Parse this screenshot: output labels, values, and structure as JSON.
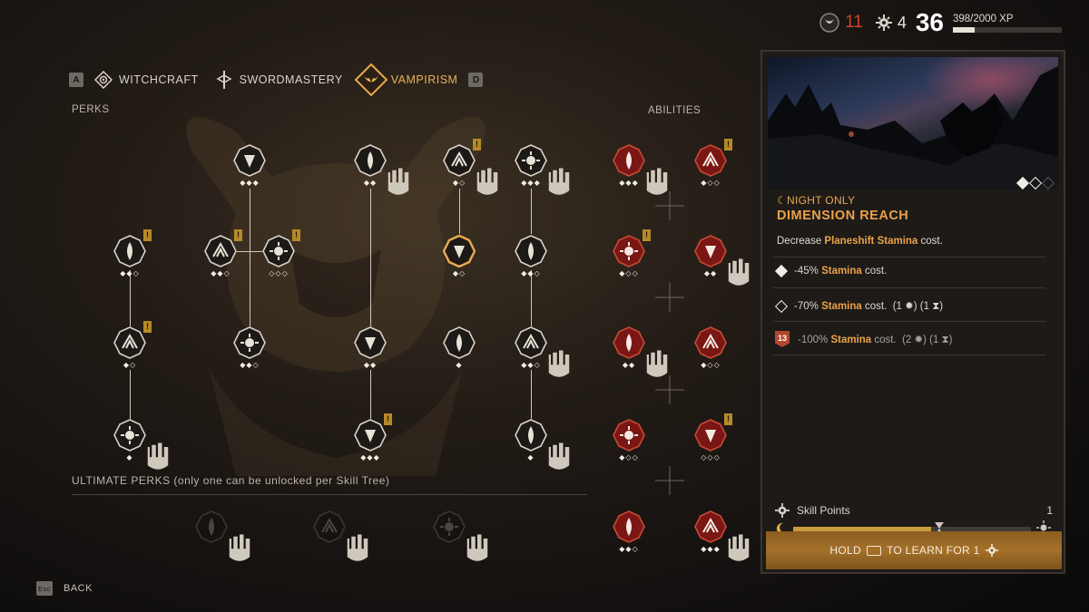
{
  "stats": {
    "blood": "11",
    "ability_points": "4",
    "level": "36",
    "xp_text": "398/2000 XP",
    "xp_progress": 0.199
  },
  "tabs": {
    "prev_key": "A",
    "next_key": "D",
    "items": [
      {
        "label": "WITCHCRAFT",
        "icon": "witchcraft-icon",
        "active": false
      },
      {
        "label": "SWORDMASTERY",
        "icon": "swordmastery-icon",
        "active": false
      },
      {
        "label": "VAMPIRISM",
        "icon": "vampirism-icon",
        "active": true
      }
    ]
  },
  "sections": {
    "perks": "PERKS",
    "abilities": "ABILITIES",
    "ultimate": "ULTIMATE PERKS (only one can be unlocked per Skill Tree)"
  },
  "perks": [
    {
      "icon": "flame-claw-icon",
      "pips": "◆◆◇",
      "alert": true,
      "locked": false
    },
    {
      "icon": "claw-bite-icon",
      "pips": "◆◆◇",
      "alert": true,
      "locked": false
    },
    {
      "icon": "sun-burst-icon",
      "pips": "◇◇◇",
      "alert": true,
      "locked": false
    },
    {
      "icon": "blood-drop-wave-icon",
      "pips": "◆◆◆",
      "alert": false,
      "locked": false
    },
    {
      "icon": "fang-icon",
      "pips": "◆◆",
      "alert": false,
      "locked": true
    },
    {
      "icon": "eye-icon",
      "pips": "◆◇",
      "alert": true,
      "locked": true
    },
    {
      "icon": "triple-drop-icon",
      "pips": "◆◆◆",
      "alert": false,
      "locked": true
    },
    {
      "icon": "mist-strike-icon",
      "pips": "◆◇",
      "alert": false,
      "locked": false
    },
    {
      "icon": "scratch-icon",
      "pips": "◆◆◇",
      "alert": false,
      "locked": false
    },
    {
      "icon": "drops-icon",
      "pips": "◆◇",
      "alert": true,
      "locked": false
    },
    {
      "icon": "paw-print-icon",
      "pips": "◆◆◇",
      "alert": false,
      "locked": false
    },
    {
      "icon": "slash-icon",
      "pips": "◆◆",
      "alert": false,
      "locked": false
    },
    {
      "icon": "demon-mask-icon",
      "pips": "◆",
      "alert": false,
      "locked": false
    },
    {
      "icon": "claw-slash-icon",
      "pips": "◆◆◇",
      "alert": false,
      "locked": true
    },
    {
      "icon": "mirror-icon",
      "pips": "◆",
      "alert": false,
      "locked": true
    },
    {
      "icon": "chalice-icon",
      "pips": "◆◆◆",
      "alert": true,
      "locked": false
    },
    {
      "icon": "hand-grab-icon",
      "pips": "◆",
      "alert": false,
      "locked": true
    }
  ],
  "abilities": [
    {
      "icon": "wolf-howl-icon",
      "pips": "◆◆◆",
      "alert": false,
      "locked": true
    },
    {
      "icon": "beast-roar-icon",
      "pips": "◆◇◇",
      "alert": true,
      "locked": false
    },
    {
      "icon": "wolf-head-icon",
      "pips": "◆◇◇",
      "alert": true,
      "locked": false
    },
    {
      "icon": "spiked-maw-icon",
      "pips": "◆◆",
      "alert": false,
      "locked": true
    },
    {
      "icon": "vortex-icon",
      "pips": "◆◆",
      "alert": false,
      "locked": true
    },
    {
      "icon": "bat-swarm-icon",
      "pips": "◆◇◇",
      "alert": false,
      "locked": false
    },
    {
      "icon": "blood-sigil-icon",
      "pips": "◆◇◇",
      "alert": false,
      "locked": false
    },
    {
      "icon": "heart-icon",
      "pips": "◇◇◇",
      "alert": true,
      "locked": false
    },
    {
      "icon": "blood-slash-icon",
      "pips": "◆◆◇",
      "alert": false,
      "locked": false
    },
    {
      "icon": "rend-icon",
      "pips": "◆◆◆",
      "alert": false,
      "locked": true
    }
  ],
  "ultimates": [
    {
      "icon": "skull-icon"
    },
    {
      "icon": "eye-fang-icon"
    },
    {
      "icon": "rune-icon"
    }
  ],
  "detail": {
    "condition": "☾NIGHT ONLY",
    "name": "DIMENSION REACH",
    "desc_prefix": "Decrease ",
    "desc_highlight": "Planeshift Stamina",
    "desc_suffix": " cost.",
    "ranks": [
      {
        "value": "-45%",
        "stat": "Stamina",
        "rest": "cost.",
        "extra": ""
      },
      {
        "value": "-70%",
        "stat": "Stamina",
        "rest": "cost.",
        "extra": "(1 ✹) (1 ⧗)"
      },
      {
        "value": "-100%",
        "stat": "Stamina",
        "rest": "cost.",
        "extra": "(2 ✹) (1 ⧗)",
        "level_req": "13"
      }
    ],
    "skill_points_label": "Skill Points",
    "skill_points_value": "1",
    "day_progress": 0.58,
    "hold_text": "HOLD",
    "learn_text": "TO LEARN FOR 1"
  },
  "back": {
    "key": "Esc",
    "label": "BACK"
  },
  "colors": {
    "accent": "#eaa24a",
    "blood": "#d2402a",
    "ability_red": "#8c1c18"
  }
}
